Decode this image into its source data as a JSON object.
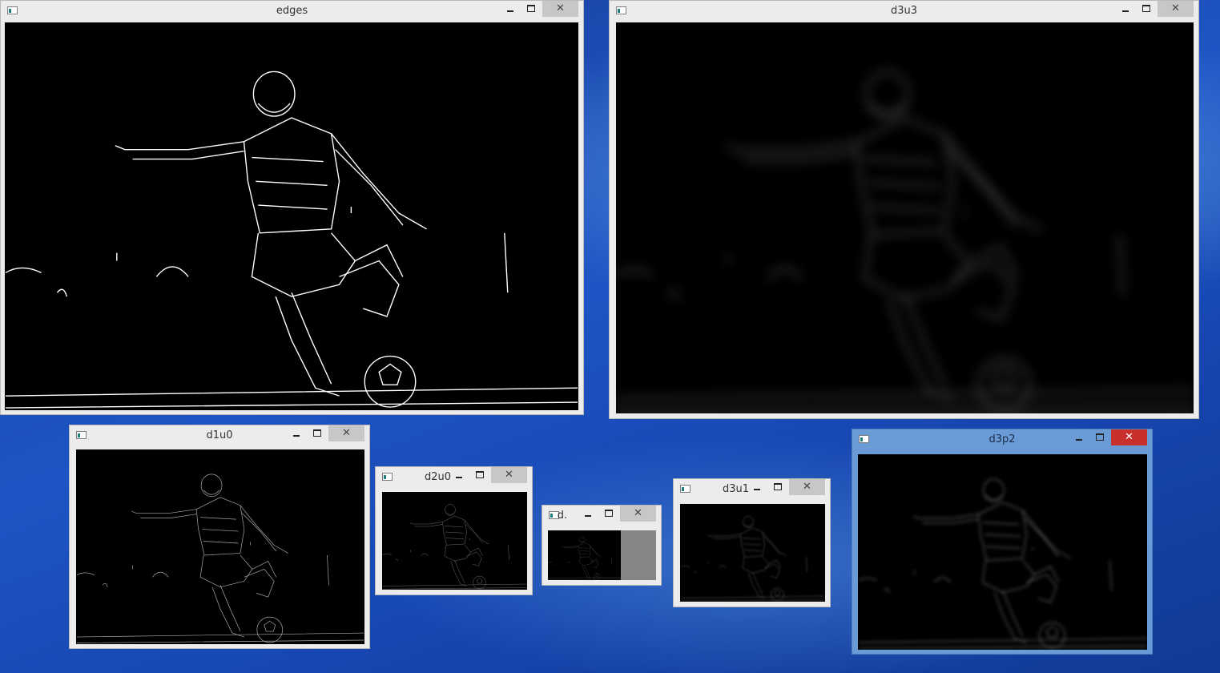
{
  "windows": {
    "edges": {
      "title": "edges",
      "close": "✕"
    },
    "d3u3": {
      "title": "d3u3",
      "close": "✕"
    },
    "d1u0": {
      "title": "d1u0",
      "close": "✕"
    },
    "d2u0": {
      "title": "d2u0",
      "close": "✕"
    },
    "d": {
      "title": "d.",
      "close": "✕"
    },
    "d3u1": {
      "title": "d3u1",
      "close": "✕"
    },
    "d3p2": {
      "title": "d3p2",
      "close": "✕"
    }
  },
  "colors": {
    "desktop": "#1d55c4",
    "active_title": "#6b9bd6",
    "close_active": "#c7302b"
  },
  "icons": [
    "app-icon",
    "minimize-icon",
    "maximize-icon",
    "close-icon"
  ]
}
